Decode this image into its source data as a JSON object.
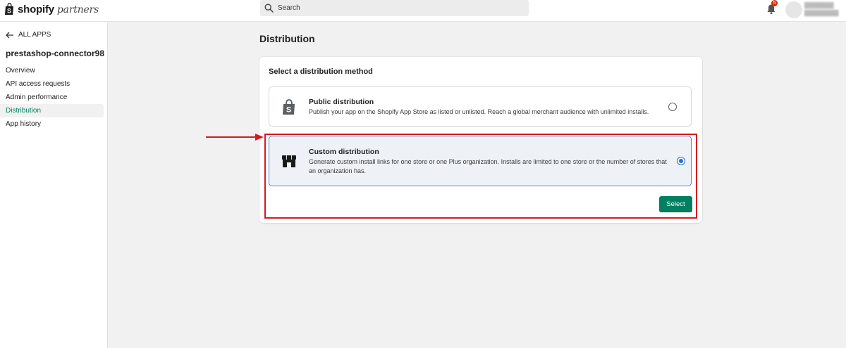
{
  "header": {
    "logo_brand": "shopify",
    "logo_sub": "partners",
    "search_placeholder": "Search",
    "notification_count": "5",
    "icons": {
      "logo": "shopify-bag-icon",
      "search": "search-icon",
      "notifications": "bell-icon"
    }
  },
  "sidebar": {
    "back_label": "ALL APPS",
    "app_name": "prestashop-connector98",
    "items": [
      {
        "label": "Overview",
        "active": false
      },
      {
        "label": "API access requests",
        "active": false
      },
      {
        "label": "Admin performance",
        "active": false
      },
      {
        "label": "Distribution",
        "active": true
      },
      {
        "label": "App history",
        "active": false
      }
    ]
  },
  "main": {
    "title": "Distribution",
    "card_title": "Select a distribution method",
    "options": [
      {
        "title": "Public distribution",
        "description": "Publish your app on the Shopify App Store as listed or unlisted. Reach a global merchant audience with unlimited installs.",
        "icon": "shopify-bag-icon",
        "selected": false
      },
      {
        "title": "Custom distribution",
        "description": "Generate custom install links for one store or one Plus organization. Installs are limited to one store or the number of stores that an organization has.",
        "icon": "storefront-icon",
        "selected": true
      }
    ],
    "select_button": "Select"
  },
  "colors": {
    "primary_button": "#008060",
    "active_nav": "#008060",
    "selected_border": "#5b7fb5",
    "radio_selected": "#2c6ecb",
    "annotation": "#d71920",
    "badge": "#d72c0d"
  }
}
